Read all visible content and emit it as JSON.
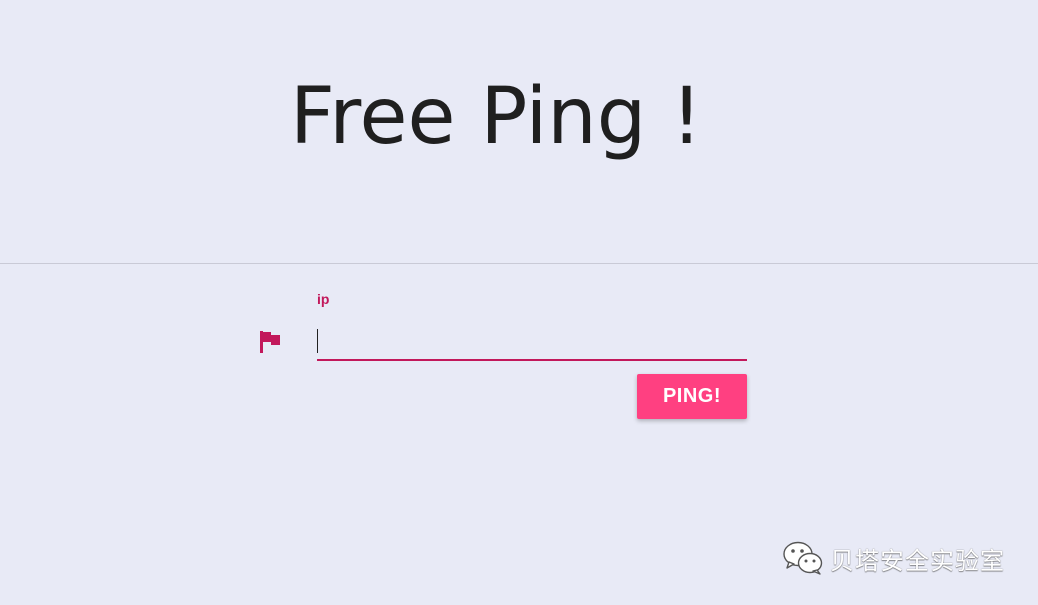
{
  "header": {
    "title": "Free Ping !"
  },
  "form": {
    "ip_label": "ip",
    "ip_value": "",
    "ip_placeholder": "",
    "submit_label": "PING!"
  },
  "icons": {
    "field_icon": "flag-icon",
    "watermark_icon": "wechat-icon"
  },
  "watermark": {
    "text": "贝塔安全实验室"
  },
  "colors": {
    "background": "#e8eaf6",
    "accent": "#c2185b",
    "button": "#ff4081",
    "title": "#1f1f1f"
  }
}
